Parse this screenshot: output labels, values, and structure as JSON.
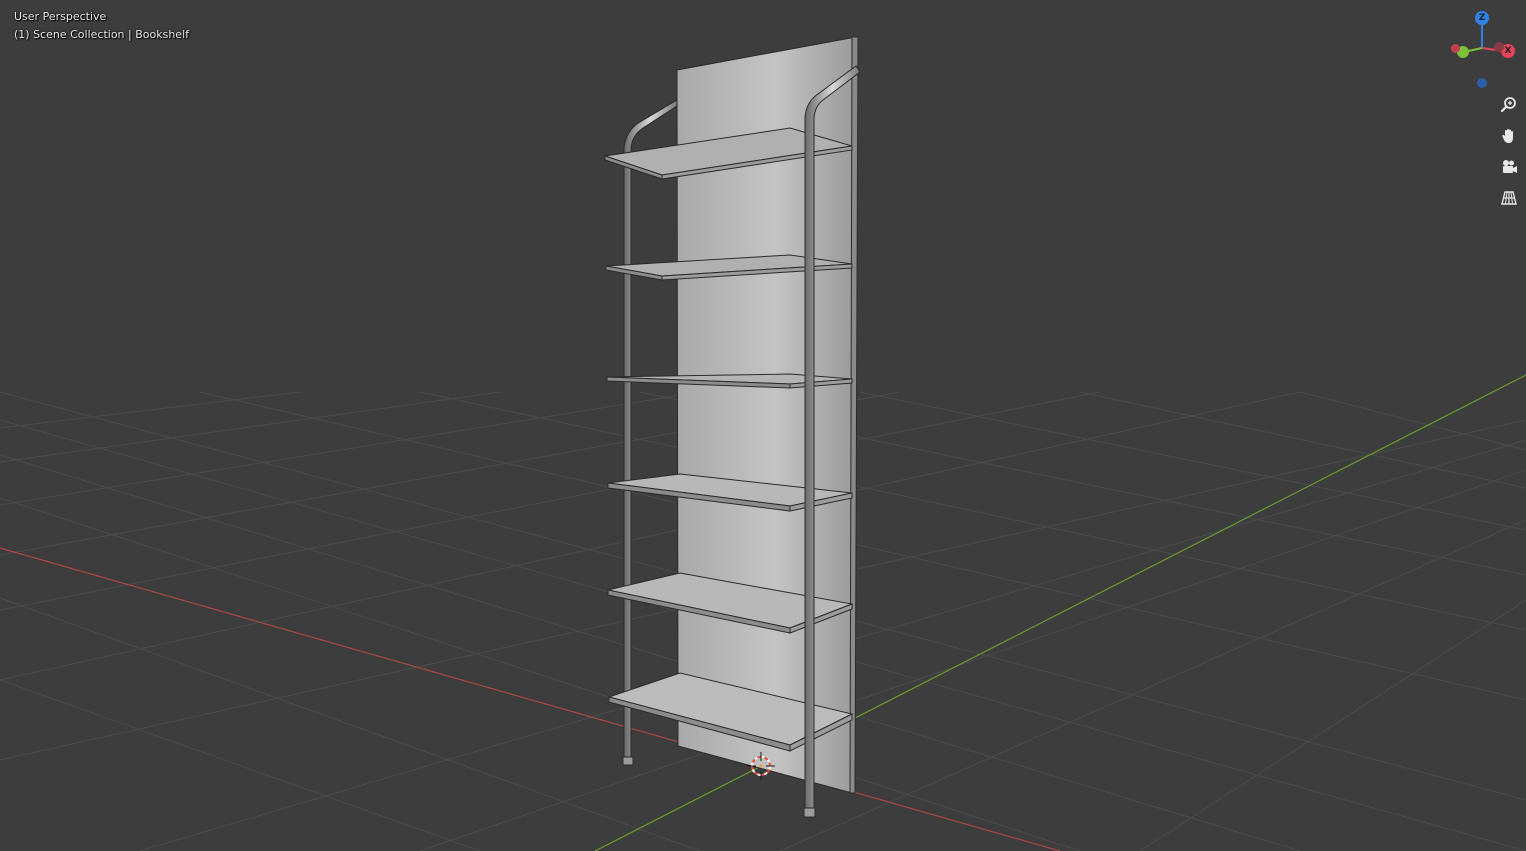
{
  "viewport": {
    "view_name": "User Perspective",
    "scene_info": "(1) Scene Collection | Bookshelf"
  },
  "gizmo": {
    "z_label": "Z",
    "x_label": "X",
    "z_color": "#2f83e6",
    "x_color": "#e4455a",
    "y_color": "#7cc13a",
    "neg_y_color": "#5c8f2f",
    "neg_z_color": "#2a5ea8"
  },
  "nav_icons": [
    "zoom-icon",
    "hand-pan-icon",
    "camera-icon",
    "grid-perspective-icon"
  ],
  "colors": {
    "background": "#3d3d3d",
    "grid_line": "#4a4a4a",
    "x_axis": "#b24a4a",
    "y_axis": "#6a9a2e",
    "mesh": "#b8b8b8",
    "mesh_edge": "#2a2a2a"
  },
  "object": {
    "name": "Bookshelf",
    "shelf_count": 6
  }
}
